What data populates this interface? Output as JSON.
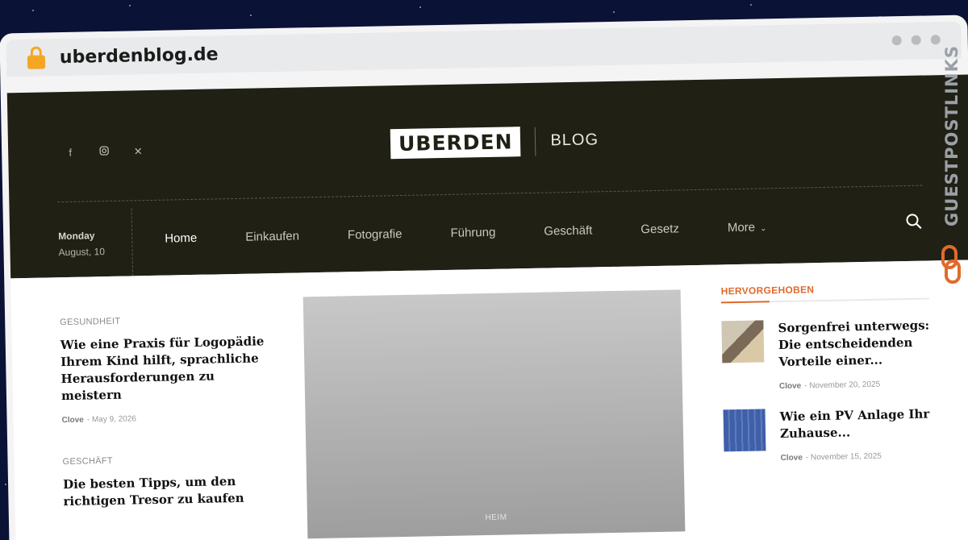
{
  "browser": {
    "url": "uberdenblog.de"
  },
  "header": {
    "logo_main": "UBERDEN",
    "logo_sub": "BLOG",
    "social": [
      "facebook-icon",
      "instagram-icon",
      "x-icon"
    ],
    "date_day": "Monday",
    "date_md": "August, 10"
  },
  "nav": {
    "items": [
      "Home",
      "Einkaufen",
      "Fotografie",
      "Führung",
      "Geschäft",
      "Gesetz",
      "More"
    ],
    "active": "Home"
  },
  "posts": [
    {
      "category": "GESUNDHEIT",
      "title": "Wie eine Praxis für Logopädie Ihrem Kind hilft, sprachliche Herausforderungen zu meistern",
      "author": "Clove",
      "date": "May 9, 2026"
    },
    {
      "category": "GESCHÄFT",
      "title": "Die besten Tipps, um den richtigen Tresor zu kaufen"
    }
  ],
  "feature": {
    "category": "HEIM"
  },
  "sidebar": {
    "heading": "HERVORGEHOBEN",
    "items": [
      {
        "title": "Sorgenfrei unterwegs: Die entscheidenden Vorteile einer...",
        "author": "Clove",
        "date": "November 20, 2025"
      },
      {
        "title": "Wie ein PV Anlage Ihr Zuhause...",
        "author": "Clove",
        "date": "November 15, 2025"
      }
    ]
  },
  "watermark": "GUESTPOSTLINKS",
  "colors": {
    "header_bg": "#212015",
    "accent": "#e06a2c",
    "lock": "#f5a623"
  }
}
